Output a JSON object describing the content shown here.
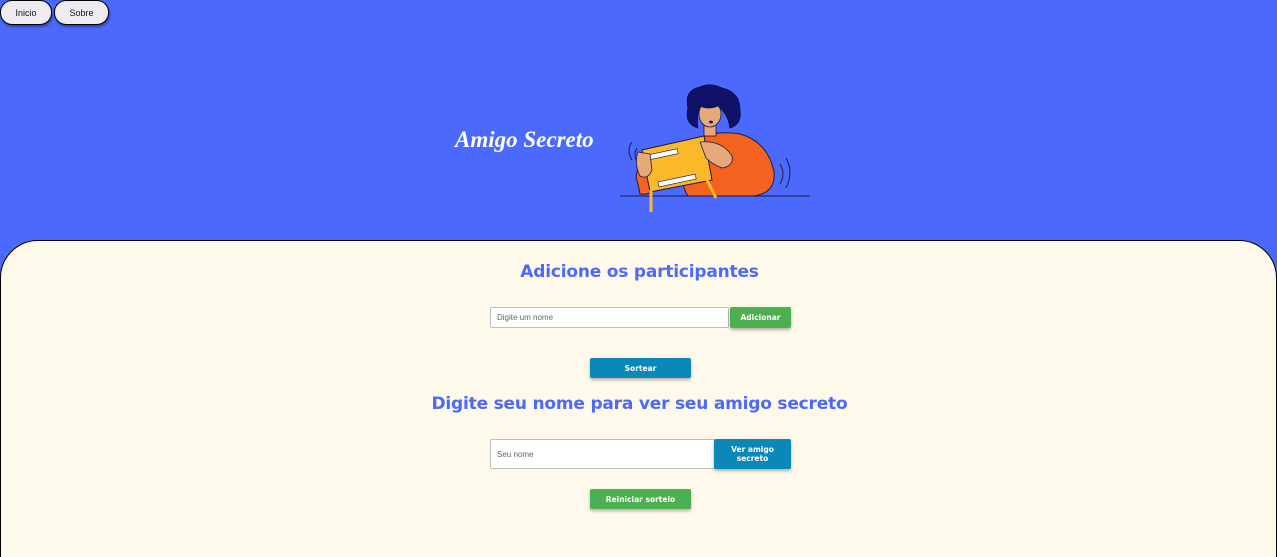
{
  "nav": {
    "items": [
      {
        "label": "Inicio"
      },
      {
        "label": "Sobre"
      }
    ]
  },
  "header": {
    "title": "Amigo Secreto",
    "illustration": "person-opening-gift-illustration"
  },
  "add_section": {
    "title": "Adicione os participantes",
    "name_placeholder": "Digite um nome",
    "add_label": "Adicionar",
    "draw_label": "Sortear"
  },
  "reveal_section": {
    "title": "Digite seu nome para ver seu amigo secreto",
    "name_placeholder": "Seu nome",
    "reveal_label": "Ver amigo secreto",
    "reset_label": "Reiniciar sorteio"
  },
  "colors": {
    "background": "#4B69FD",
    "card": "#FFF9EB",
    "accent_text": "#4B69FD",
    "green_button": "#4CAF50",
    "blue_button": "#0A89B8"
  }
}
